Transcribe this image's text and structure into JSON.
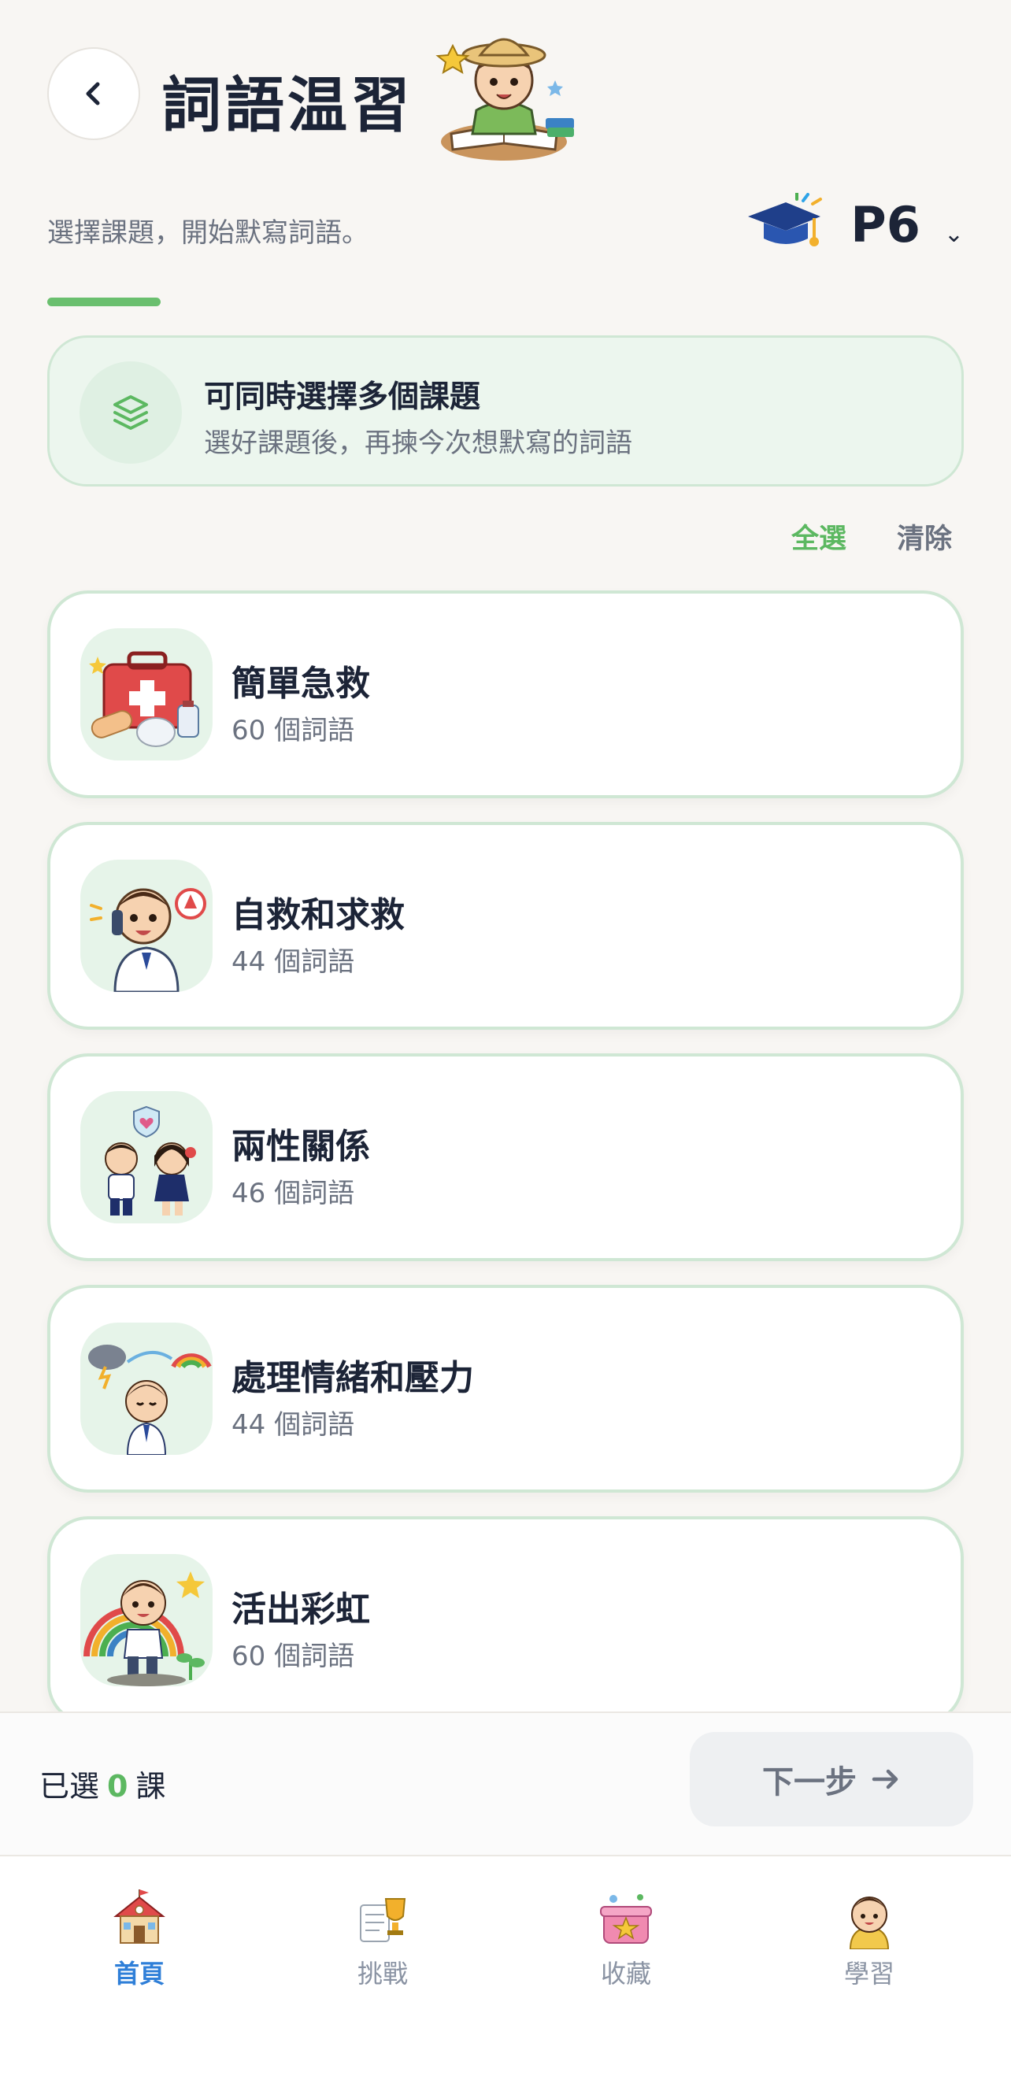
{
  "header": {
    "title": "詞語温習",
    "subtitle": "選擇課題，開始默寫詞語。",
    "grade": "P6"
  },
  "banner": {
    "title": "可同時選擇多個課題",
    "description": "選好課題後，再揀今次想默寫的詞語"
  },
  "actions": {
    "select_all": "全選",
    "clear": "清除"
  },
  "topics": [
    {
      "name": "簡單急救",
      "count": "60 個詞語",
      "icon": "first-aid-kit"
    },
    {
      "name": "自救和求救",
      "count": "44 個詞語",
      "icon": "boy-calling-help"
    },
    {
      "name": "兩性關係",
      "count": "46 個詞語",
      "icon": "boy-and-girl"
    },
    {
      "name": "處理情緒和壓力",
      "count": "44 個詞語",
      "icon": "calm-boy-weather"
    },
    {
      "name": "活出彩虹",
      "count": "60 個詞語",
      "icon": "boy-rainbow"
    }
  ],
  "footer": {
    "selected_prefix": "已選",
    "selected_count": "0",
    "selected_suffix": "課",
    "next_label": "下一步"
  },
  "tabs": [
    {
      "label": "首頁",
      "icon": "school-house",
      "active": true
    },
    {
      "label": "挑戰",
      "icon": "trophy-scroll",
      "active": false
    },
    {
      "label": "收藏",
      "icon": "star-box",
      "active": false
    },
    {
      "label": "學習",
      "icon": "boy-avatar",
      "active": false
    }
  ],
  "colors": {
    "accent_green": "#5cb861",
    "active_tab": "#2f7fd8",
    "card_border": "#cfe7d4"
  }
}
